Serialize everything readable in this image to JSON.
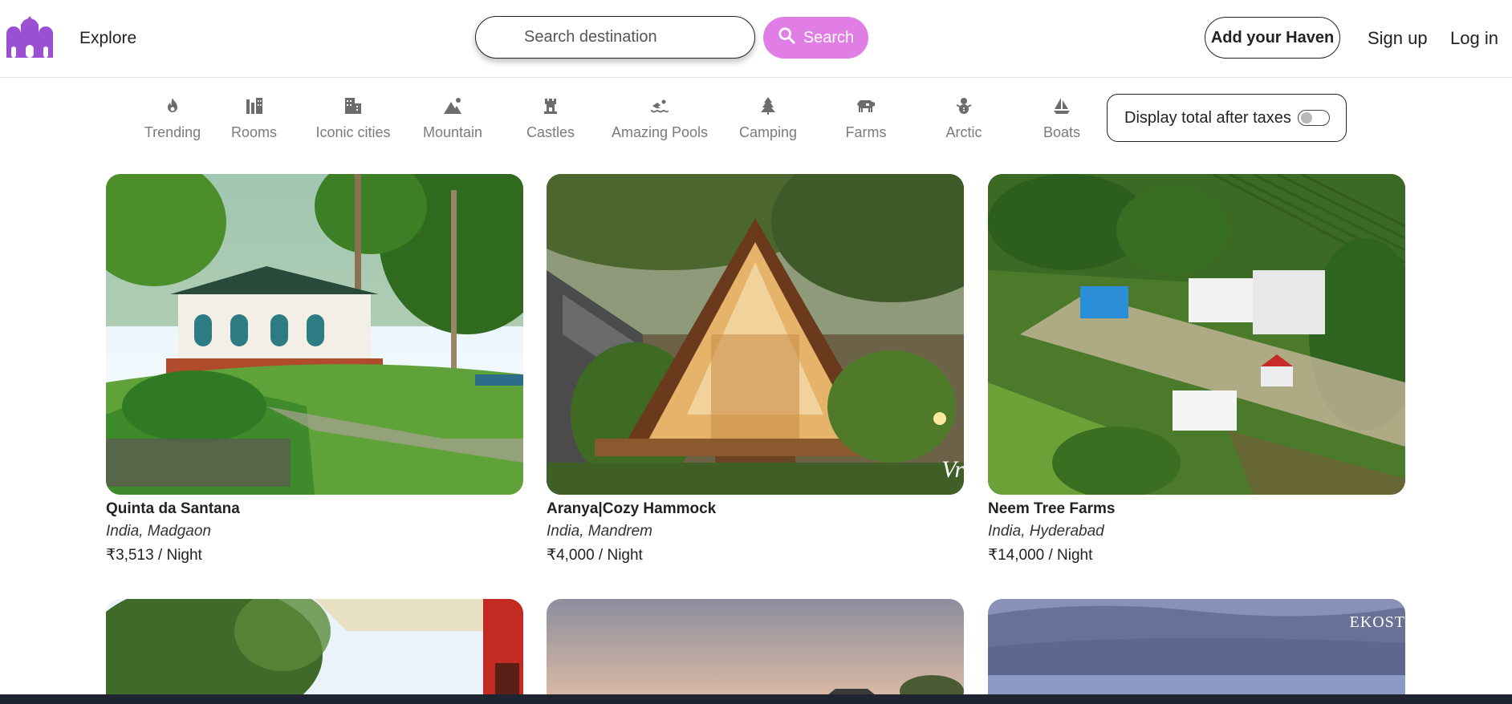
{
  "nav": {
    "explore": "Explore",
    "search_placeholder": "Search destination",
    "search_button": "Search",
    "add_haven": "Add your Haven",
    "signup": "Sign up",
    "login": "Log in",
    "brand_color": "#9b4fd3",
    "search_color": "#e07ee6"
  },
  "filters": [
    {
      "label": "Trending",
      "icon": "fire-icon"
    },
    {
      "label": "Rooms",
      "icon": "bed-icon"
    },
    {
      "label": "Iconic cities",
      "icon": "city-icon"
    },
    {
      "label": "Mountain",
      "icon": "mountain-icon"
    },
    {
      "label": "Castles",
      "icon": "castle-icon"
    },
    {
      "label": "Amazing Pools",
      "icon": "swimmer-icon"
    },
    {
      "label": "Camping",
      "icon": "tree-icon"
    },
    {
      "label": "Farms",
      "icon": "cow-icon"
    },
    {
      "label": "Arctic",
      "icon": "snowman-icon"
    },
    {
      "label": "Boats",
      "icon": "sailboat-icon"
    }
  ],
  "tax_toggle": {
    "label": "Display total after taxes",
    "enabled": false
  },
  "listings": [
    {
      "title": "Quinta da Santana",
      "location": "India, Madgaon",
      "price": "₹3,513 / Night"
    },
    {
      "title": "Aranya|Cozy Hammock",
      "location": "India, Mandrem",
      "price": "₹4,000 / Night"
    },
    {
      "title": "Neem Tree Farms",
      "location": "India, Hyderabad",
      "price": "₹14,000 / Night"
    }
  ],
  "image_watermarks": {
    "aranya": "Vr",
    "ekost": "EKOST"
  }
}
